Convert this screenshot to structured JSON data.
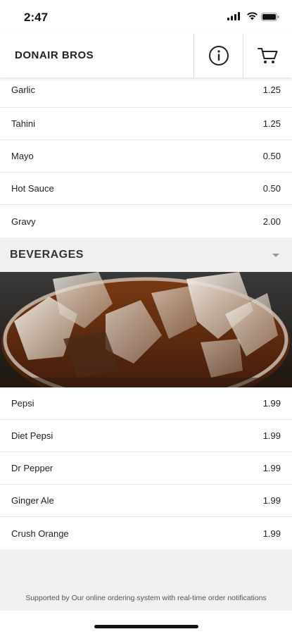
{
  "status_bar": {
    "time": "2:47",
    "icons": [
      "signal-icon",
      "wifi-icon",
      "battery-icon"
    ]
  },
  "header": {
    "title": "DONAIR BROS",
    "buttons": [
      "info-icon",
      "cart-icon"
    ]
  },
  "condiments": [
    {
      "name": "Garlic",
      "price": "1.25"
    },
    {
      "name": "Tahini",
      "price": "1.25"
    },
    {
      "name": "Mayo",
      "price": "0.50"
    },
    {
      "name": "Hot Sauce",
      "price": "0.50"
    },
    {
      "name": "Gravy",
      "price": "2.00"
    }
  ],
  "beverages_section": {
    "title": "BEVERAGES",
    "expand_icon": "caret-down-icon",
    "image": "cola-glass-with-ice-image"
  },
  "beverages": [
    {
      "name": "Pepsi",
      "price": "1.99"
    },
    {
      "name": "Diet Pepsi",
      "price": "1.99"
    },
    {
      "name": "Dr Pepper",
      "price": "1.99"
    },
    {
      "name": "Ginger Ale",
      "price": "1.99"
    },
    {
      "name": "Crush Orange",
      "price": "1.99"
    }
  ],
  "footer": {
    "text": "Supported by Our online ordering system with real-time order notifications"
  },
  "colors": {
    "background": "#f2f2f2",
    "surface": "#ffffff",
    "text": "#222222",
    "divider": "#e6e6e6"
  }
}
